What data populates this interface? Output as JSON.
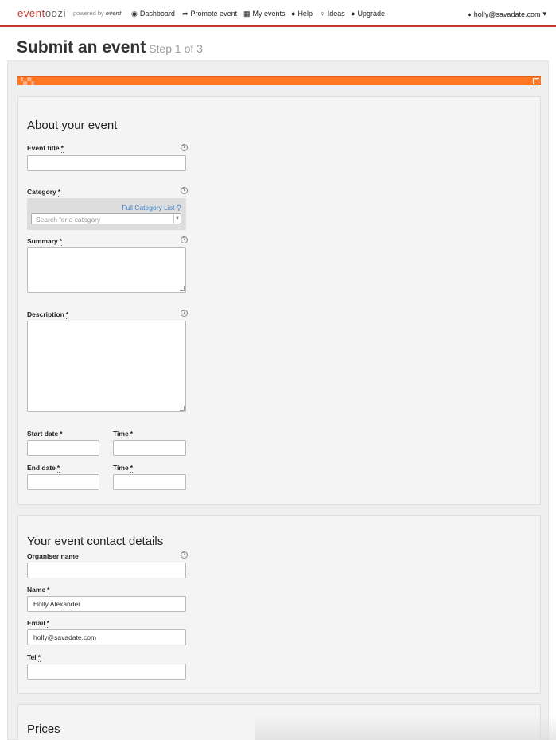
{
  "header": {
    "logo_prefix": "even",
    "logo_mid": "t",
    "logo_suffix": "oozi",
    "powered_by": "powered by",
    "powered_brand": "event",
    "nav": [
      {
        "icon": "dashboard-icon",
        "glyph": "◉",
        "label": "Dashboard"
      },
      {
        "icon": "share-arrow-icon",
        "glyph": "➦",
        "label": "Promote event"
      },
      {
        "icon": "calendar-icon",
        "glyph": "▦",
        "label": "My events"
      },
      {
        "icon": "info-icon",
        "glyph": "●",
        "label": "Help"
      },
      {
        "icon": "lightbulb-icon",
        "glyph": "♀",
        "label": "Ideas"
      },
      {
        "icon": "upload-icon",
        "glyph": "●",
        "label": "Upgrade"
      }
    ],
    "user_email": "holly@savadate.com",
    "user_caret": "▾"
  },
  "page": {
    "title": "Submit an event",
    "step": "Step 1 of 3"
  },
  "about": {
    "title": "About your event",
    "event_title_label": "Event title",
    "category_label": "Category",
    "full_category_list": "Full Category List",
    "category_placeholder": "Search for a category",
    "summary_label": "Summary",
    "description_label": "Description",
    "start_date_label": "Start date",
    "start_time_label": "Time",
    "end_date_label": "End date",
    "end_time_label": "Time",
    "required_mark": "*"
  },
  "contact": {
    "title": "Your event contact details",
    "organiser_label": "Organiser name",
    "organiser_value": "",
    "name_label": "Name",
    "name_value": "Holly Alexander",
    "email_label": "Email",
    "email_value": "holly@savadate.com",
    "tel_label": "Tel",
    "tel_value": ""
  },
  "prices": {
    "title": "Prices"
  },
  "colors": {
    "accent_orange": "#ff7722",
    "nav_border_red": "#c0392b",
    "link_blue": "#3a7ec6"
  }
}
